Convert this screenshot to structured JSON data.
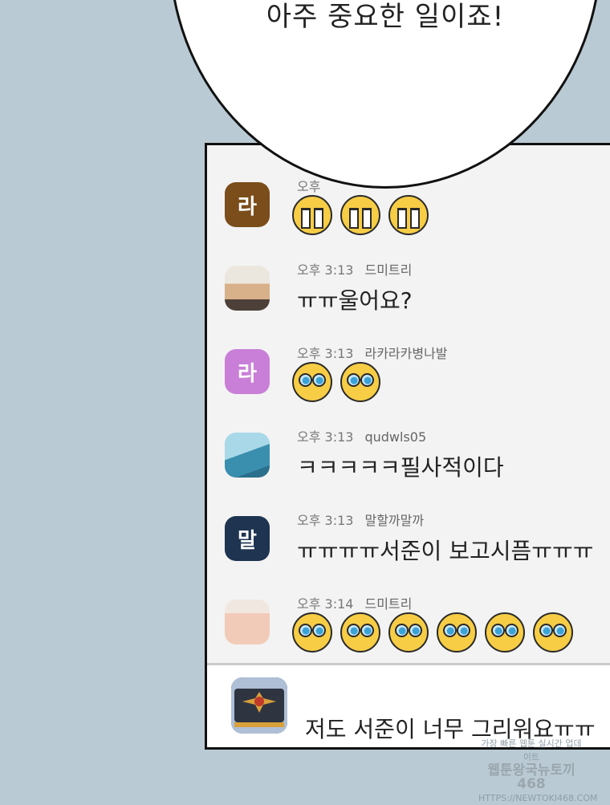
{
  "speech_bubble": {
    "text": "아주 중요한 일이죠!"
  },
  "chat": {
    "messages": [
      {
        "time": "오후",
        "name": "",
        "avatar_label": "라",
        "avatar_color": "#7a4d1a",
        "content_type": "emoji",
        "emoji": "crying-face",
        "emoji_count": 3
      },
      {
        "time": "오후 3:13",
        "name": "드미트리",
        "avatar_label": "",
        "content_type": "text",
        "text": "ㅠㅠ울어요?"
      },
      {
        "time": "오후 3:13",
        "name": "라카라카병나발",
        "avatar_label": "라",
        "avatar_color": "#c97fd8",
        "content_type": "emoji",
        "emoji": "teary-eyes-face",
        "emoji_count": 2
      },
      {
        "time": "오후 3:13",
        "name": "qudwls05",
        "avatar_label": "",
        "content_type": "text",
        "text": "ㅋㅋㅋㅋㅋ필사적이다"
      },
      {
        "time": "오후 3:13",
        "name": "말할까말까",
        "avatar_label": "말",
        "avatar_color": "#1e3450",
        "content_type": "text",
        "text": "ㅠㅠㅠㅠ서준이 보고시픔ㅠㅠㅠ"
      },
      {
        "time": "오후 3:14",
        "name": "드미트리",
        "avatar_label": "",
        "content_type": "emoji",
        "emoji": "teary-eyes-face",
        "emoji_count": 6
      }
    ],
    "composer": {
      "text": "저도 서준이 너무 그리워요ㅠㅠ"
    }
  },
  "watermark": {
    "line1": "가장 빠른 웹툰 실시간 업데이트",
    "line2": "웹툰왕국뉴토끼468",
    "line3": "HTTPS://NEWTOKI468.COM"
  }
}
